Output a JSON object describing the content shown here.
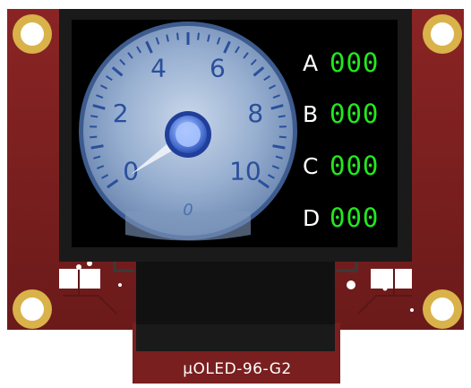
{
  "product": {
    "model_label": "µOLED-96-G2"
  },
  "gauge": {
    "scale_labels": [
      "0",
      "2",
      "4",
      "6",
      "8",
      "10"
    ],
    "center_value": "0",
    "needle_value": 0,
    "scale_min": 0,
    "scale_max": 10
  },
  "channels": [
    {
      "label": "A",
      "value": "000"
    },
    {
      "label": "B",
      "value": "000"
    },
    {
      "label": "C",
      "value": "000"
    },
    {
      "label": "D",
      "value": "000"
    }
  ],
  "colors": {
    "pcb": "#7a1f1f",
    "pad_gold": "#d9b24a",
    "screen_bg": "#000000",
    "digits": "#22e81e",
    "gauge_face": "#8fa7c9",
    "gauge_numerals": "#2a4f9c"
  }
}
